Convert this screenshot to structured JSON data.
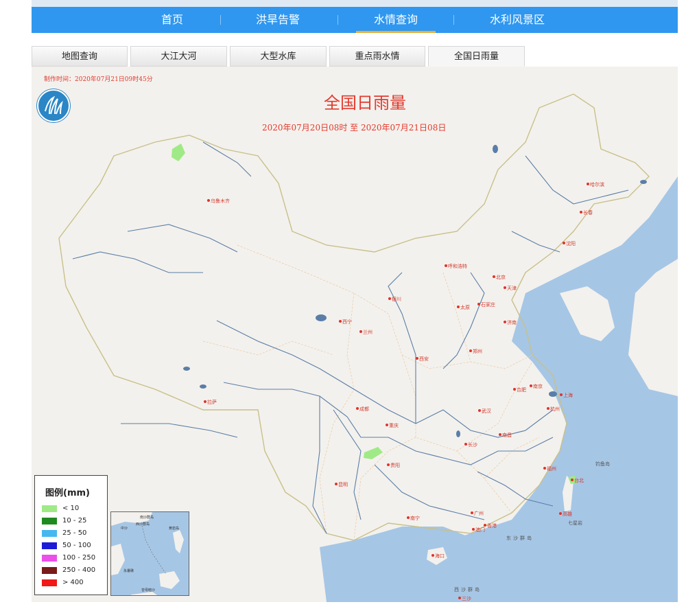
{
  "nav": {
    "items": [
      {
        "label": "首页",
        "active": false
      },
      {
        "label": "洪旱告警",
        "active": false
      },
      {
        "label": "水情查询",
        "active": true
      },
      {
        "label": "水利风景区",
        "active": false
      }
    ],
    "accent_color": "#2f97ef",
    "active_underline_color": "#e9b03a"
  },
  "tabs": [
    {
      "label": "地图查询",
      "active": false
    },
    {
      "label": "大江大河",
      "active": false
    },
    {
      "label": "大型水库",
      "active": false
    },
    {
      "label": "重点雨水情",
      "active": false
    },
    {
      "label": "全国日雨量",
      "active": true
    }
  ],
  "map": {
    "make_time": "制作时间：2020年07月21日09时45分",
    "title": "全国日雨量",
    "date_range": "2020年07月20日08时  至  2020年07月21日08日",
    "cities": [
      "乌鲁木齐",
      "哈尔滨",
      "长春",
      "沈阳",
      "呼和浩特",
      "北京",
      "天津",
      "银川",
      "太原",
      "石家庄",
      "济南",
      "西宁",
      "兰州",
      "西安",
      "郑州",
      "南京",
      "合肥",
      "上海",
      "杭州",
      "武汉",
      "南昌",
      "长沙",
      "重庆",
      "成都",
      "拉萨",
      "贵阳",
      "昆明",
      "南宁",
      "广州",
      "福州",
      "台北",
      "高雄",
      "海口",
      "澳门",
      "香港",
      "三沙"
    ],
    "sea_labels": [
      "钓鱼岛",
      "东沙群岛",
      "七星岩",
      "西沙群岛"
    ],
    "inset": {
      "labels": [
        "南沙群岛",
        "中沙",
        "西沙群岛",
        "黄岩岛",
        "永暑礁",
        "曾母暗沙"
      ]
    }
  },
  "legend": {
    "title": "图例(mm)",
    "items": [
      {
        "label": "< 10",
        "color": "#9fea86"
      },
      {
        "label": "10 - 25",
        "color": "#1f8a1f"
      },
      {
        "label": "25 - 50",
        "color": "#46b8f0"
      },
      {
        "label": "50 - 100",
        "color": "#1c1cd6"
      },
      {
        "label": "100 - 250",
        "color": "#ea4fea"
      },
      {
        "label": "250 - 400",
        "color": "#7a1a1a"
      },
      {
        "label": "> 400",
        "color": "#f01818"
      }
    ]
  },
  "colors": {
    "title_red": "#e23a2e",
    "sea": "#a6c6e5",
    "land": "#f3f1ed",
    "river": "#5a7ea8",
    "province_border": "#e8c9a0",
    "national_border": "#c8c08a"
  }
}
